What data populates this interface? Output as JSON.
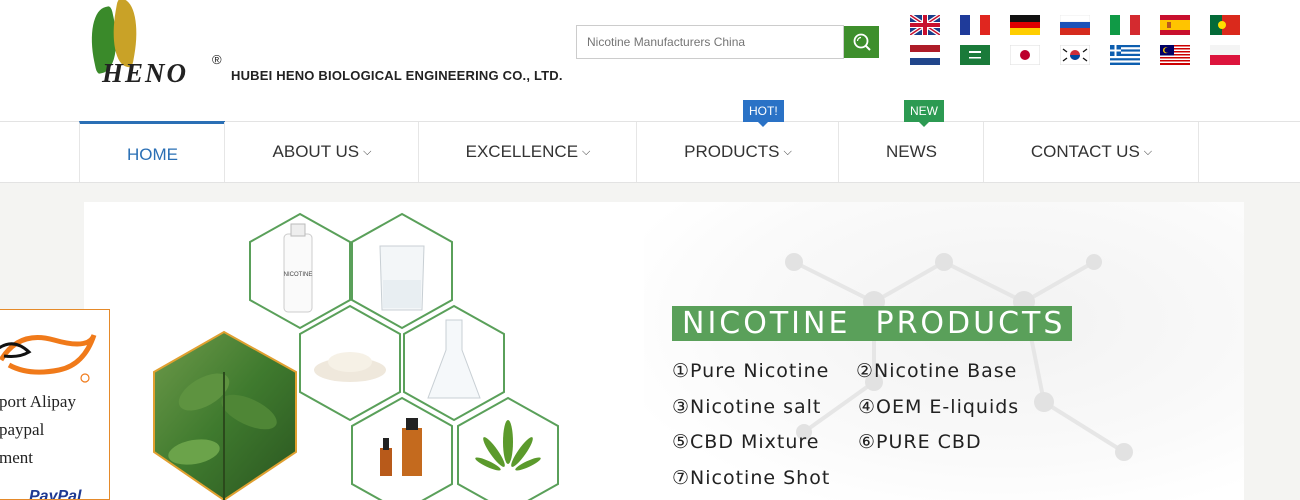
{
  "header": {
    "logo_word": "HENO",
    "logo_reg": "®",
    "company_name": "HUBEI HENO BIOLOGICAL ENGINEERING CO., LTD."
  },
  "search": {
    "placeholder": "Nicotine Manufacturers China",
    "button_icon": "search-icon"
  },
  "languages": [
    "english-flag",
    "french-flag",
    "german-flag",
    "russian-flag",
    "italian-flag",
    "spanish-flag",
    "portuguese-flag",
    "dutch-flag",
    "arabic-flag",
    "japanese-flag",
    "korean-flag",
    "greek-flag",
    "malay-flag",
    "polish-flag"
  ],
  "nav": {
    "items": [
      {
        "label": "HOME",
        "caret": ""
      },
      {
        "label": "ABOUT US",
        "caret": "⌵"
      },
      {
        "label": "EXCELLENCE",
        "caret": "⌵"
      },
      {
        "label": "PRODUCTS",
        "caret": "⌵"
      },
      {
        "label": "NEWS",
        "caret": ""
      },
      {
        "label": "CONTACT US",
        "caret": "⌵"
      }
    ],
    "hot_tag": "HOT!",
    "new_tag": "NEW"
  },
  "banner": {
    "title": "NICOTINE  PRODUCTS",
    "bottle_label": "NICOTINE",
    "products": [
      "①Pure Nicotine",
      "②Nicotine Base",
      "③Nicotine salt",
      "④OEM E-liquids",
      "⑤CBD Mixture",
      "⑥PURE CBD",
      "⑦Nicotine Shot"
    ]
  },
  "alipay": {
    "line1": "port Alipay",
    "line2": "paypal",
    "line3": "ment",
    "paypal_logo": "PayPal"
  },
  "colors": {
    "accent_blue": "#2a6fb5",
    "search_green": "#3e8f2c",
    "title_green": "#5aa05a",
    "hot_blue": "#2a72c6",
    "new_green": "#2c9a52",
    "alipay_orange": "#e58a2a"
  }
}
